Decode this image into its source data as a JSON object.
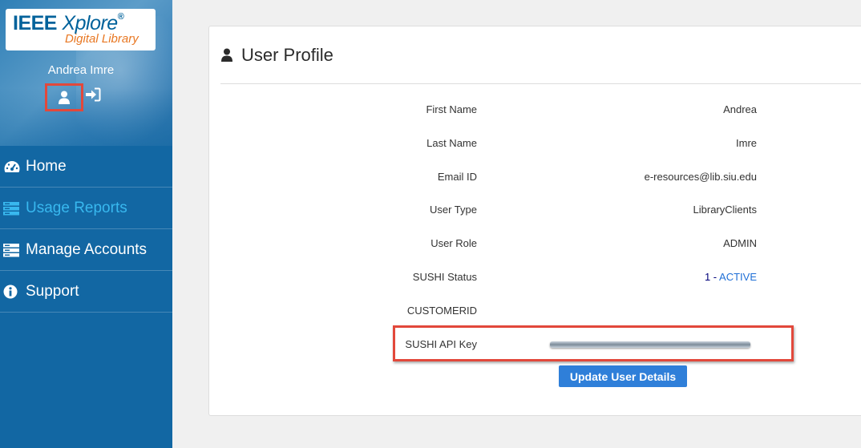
{
  "sidebar": {
    "logo": {
      "brand_bold": "IEEE",
      "brand_italic": "Xplore",
      "reg_mark": "®",
      "subtitle": "Digital Library"
    },
    "user_name": "Andrea Imre",
    "nav": [
      {
        "label": "Home",
        "icon": "dashboard-icon",
        "active": false
      },
      {
        "label": "Usage Reports",
        "icon": "server-icon",
        "active": true
      },
      {
        "label": "Manage Accounts",
        "icon": "server-icon",
        "active": false
      },
      {
        "label": "Support",
        "icon": "info-icon",
        "active": false
      }
    ]
  },
  "profile": {
    "title": "User Profile",
    "fields": [
      {
        "label": "First Name",
        "value": "Andrea"
      },
      {
        "label": "Last Name",
        "value": "Imre"
      },
      {
        "label": "Email ID",
        "value": "e-resources@lib.siu.edu"
      },
      {
        "label": "User Type",
        "value": "LibraryClients"
      },
      {
        "label": "User Role",
        "value": "ADMIN"
      },
      {
        "label": "SUSHI Status",
        "value_num": "1 - ",
        "value_text": "ACTIVE"
      },
      {
        "label": "CUSTOMERID",
        "value": ""
      },
      {
        "label": "SUSHI API Key",
        "value": ""
      }
    ],
    "update_button": "Update User Details"
  },
  "colors": {
    "sidebar_bg": "#1267a3",
    "active_nav": "#38b8ef",
    "highlight_border": "#e2483b",
    "button_bg": "#2f7fd9",
    "status_active": "#1f6fd6"
  }
}
